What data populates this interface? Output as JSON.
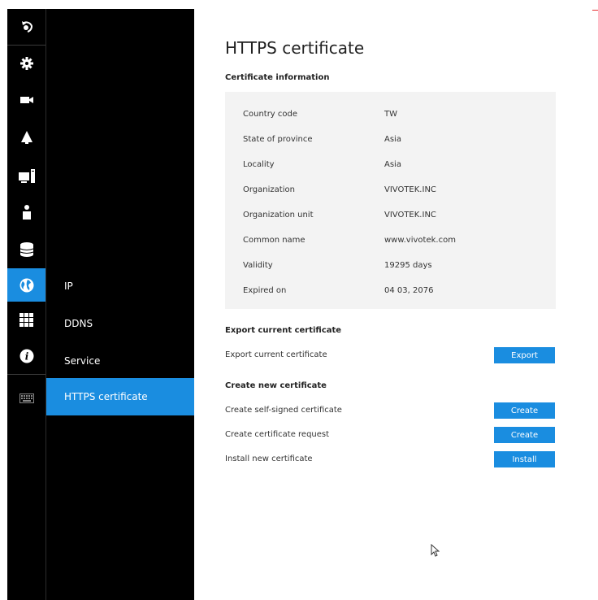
{
  "sidebar": {
    "icons": [
      {
        "name": "back-icon",
        "active": false
      },
      {
        "name": "gear-icon",
        "active": false
      },
      {
        "name": "camera-icon",
        "active": false
      },
      {
        "name": "bell-icon",
        "active": false
      },
      {
        "name": "computer-icon",
        "active": false
      },
      {
        "name": "user-icon",
        "active": false
      },
      {
        "name": "database-icon",
        "active": false
      },
      {
        "name": "globe-icon",
        "active": true
      },
      {
        "name": "grid-icon",
        "active": false
      },
      {
        "name": "info-icon",
        "active": false
      },
      {
        "name": "keyboard-icon",
        "active": false
      }
    ]
  },
  "subnav": {
    "items": [
      {
        "label": "IP",
        "active": false
      },
      {
        "label": "DDNS",
        "active": false
      },
      {
        "label": "Service",
        "active": false
      },
      {
        "label": "HTTPS certificate",
        "active": true
      }
    ]
  },
  "page": {
    "title": "HTTPS certificate",
    "info_header": "Certificate information",
    "info": [
      {
        "label": "Country code",
        "value": "TW"
      },
      {
        "label": "State of province",
        "value": "Asia"
      },
      {
        "label": "Locality",
        "value": "Asia"
      },
      {
        "label": "Organization",
        "value": "VIVOTEK.INC"
      },
      {
        "label": "Organization unit",
        "value": "VIVOTEK.INC"
      },
      {
        "label": "Common name",
        "value": "www.vivotek.com"
      },
      {
        "label": "Validity",
        "value": "19295 days"
      },
      {
        "label": "Expired on",
        "value": "04 03, 2076"
      }
    ],
    "export_header": "Export current certificate",
    "export_row": {
      "label": "Export current certificate",
      "button": "Export"
    },
    "create_header": "Create new certificate",
    "create_rows": [
      {
        "label": "Create self-signed certificate",
        "button": "Create"
      },
      {
        "label": "Create certificate request",
        "button": "Create"
      },
      {
        "label": "Install new certificate",
        "button": "Install"
      }
    ]
  },
  "colors": {
    "accent": "#1a8de0",
    "sidebar_bg": "#000000",
    "panel_bg": "#f3f3f3"
  }
}
